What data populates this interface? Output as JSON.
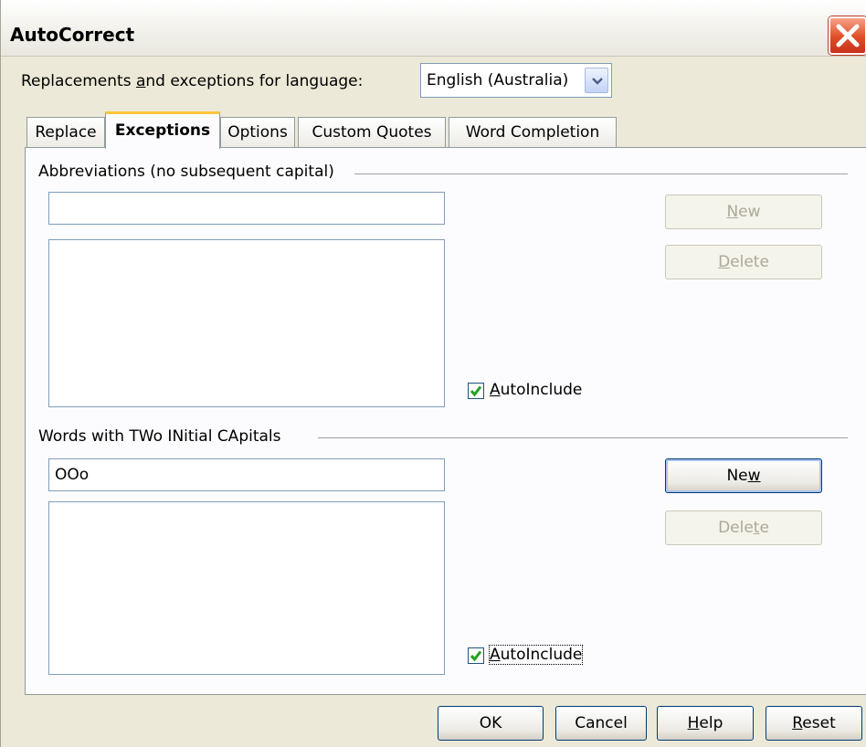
{
  "window": {
    "title": "AutoCorrect",
    "close_icon": "close-icon"
  },
  "language": {
    "label_pre": "Replacements ",
    "label_hot": "a",
    "label_post": "nd exceptions for language:",
    "selected": "English (Australia)"
  },
  "tabs": [
    {
      "label": "Replace"
    },
    {
      "label": "Exceptions"
    },
    {
      "label": "Options"
    },
    {
      "label": "Custom Quotes"
    },
    {
      "label": "Word Completion"
    }
  ],
  "abbreviations": {
    "title": "Abbreviations (no subsequent capital)",
    "input_value": "",
    "new_hot": "N",
    "new_rest": "ew",
    "delete_hot": "D",
    "delete_rest": "elete",
    "autoinclude_hot": "A",
    "autoinclude_rest": "utoInclude",
    "autoinclude_checked": true
  },
  "two_capitals": {
    "title": "Words with TWo INitial CApitals",
    "input_value": "OOo",
    "new_pre": "Ne",
    "new_hot": "w",
    "delete_pre": "Dele",
    "delete_hot": "t",
    "delete_post": "e",
    "autoinclude_hot": "A",
    "autoinclude_rest": "utoInclude",
    "autoinclude_checked": true
  },
  "footer": {
    "ok": "OK",
    "cancel": "Cancel",
    "help_hot": "H",
    "help_rest": "elp",
    "reset_hot": "R",
    "reset_rest": "eset"
  },
  "colors": {
    "dialog_bg": "#ece9d8",
    "active_tab_accent": "#ffc73c",
    "check_color": "#21a121",
    "close_button": "#de4d27"
  }
}
